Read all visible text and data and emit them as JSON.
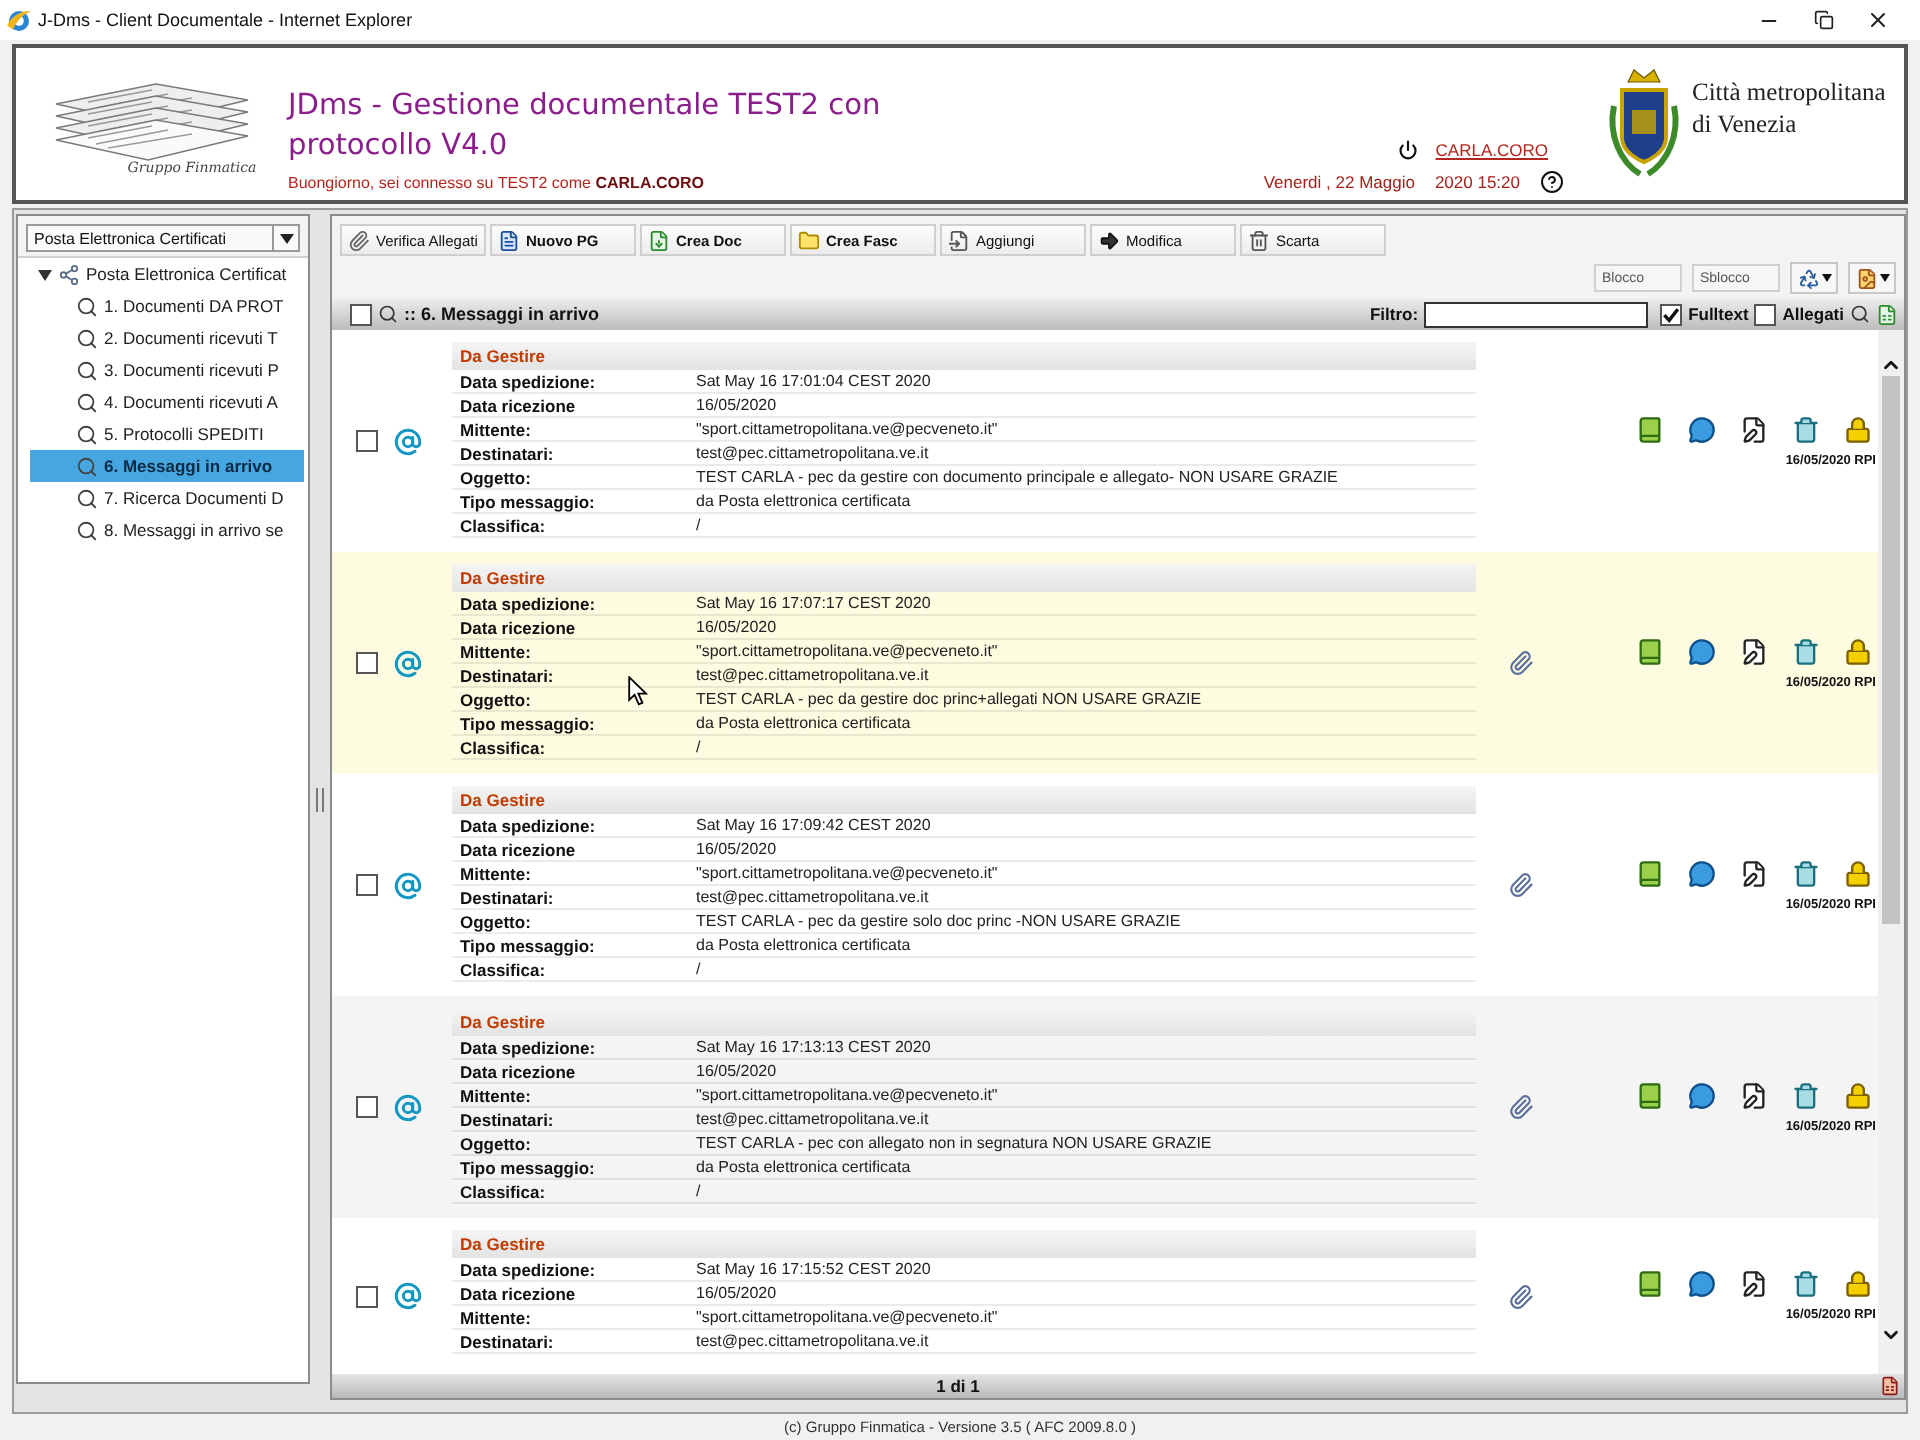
{
  "window": {
    "title": "J-Dms - Client Documentale - Internet Explorer"
  },
  "header": {
    "logo_caption": "Gruppo Finmatica",
    "title": "JDms - Gestione documentale TEST2 con protocollo V4.0",
    "greeting": "Buongiorno, sei connesso su TEST2 come **CARLA.CORO**",
    "user": "CARLA.CORO",
    "date": "Venerdi , 22 Maggio",
    "time": "2020 15:20",
    "organization": "Città metropolitana di Venezia"
  },
  "sidebar": {
    "dropdown": "Posta Elettronica Certificati",
    "tree": [
      {
        "label": "Posta Elettronica Certificat",
        "expanded": true,
        "selected": false,
        "children": [
          {
            "label": "1. Documenti DA PROT",
            "selected": false
          },
          {
            "label": "2. Documenti ricevuti T",
            "selected": false
          },
          {
            "label": "3. Documenti ricevuti P",
            "selected": false
          },
          {
            "label": "4. Documenti ricevuti A",
            "selected": false
          },
          {
            "label": "5. Protocolli SPEDITI",
            "selected": false
          },
          {
            "label": "6. Messaggi in arrivo",
            "selected": true
          },
          {
            "label": "7. Ricerca Documenti D",
            "selected": false
          },
          {
            "label": "8. Messaggi in arrivo se",
            "selected": false
          }
        ]
      }
    ]
  },
  "toolbar": {
    "buttons": [
      {
        "label": "Verifica Allegati",
        "emphasized": false
      },
      {
        "label": "Nuovo PG",
        "emphasized": true
      },
      {
        "label": "Crea Doc",
        "emphasized": true
      },
      {
        "label": "Crea Fasc",
        "emphasized": true
      },
      {
        "label": "Aggiungi",
        "emphasized": false
      },
      {
        "label": "Modifica",
        "emphasized": false
      },
      {
        "label": "Scarta",
        "emphasized": false
      }
    ],
    "lock_buttons": [
      "Blocco",
      "Sblocco"
    ]
  },
  "list": {
    "title": ":: 6. Messaggi in arrivo",
    "select_all": {
      "checked": false
    },
    "filter": {
      "label": "Filtro:"
    },
    "options": [
      {
        "label": "Fulltext",
        "checked": true
      },
      {
        "label": "Allegati",
        "checked": false
      }
    ],
    "messages": [
      {
        "checked": false,
        "hovered": false,
        "status": "Da Gestire",
        "attachment": false,
        "stamp": "16/05/2020 RPI",
        "fields": [
          {
            "label": "Data spedizione:",
            "value": "Sat May 16 17:01:04 CEST 2020"
          },
          {
            "label": "Data ricezione",
            "value": "16/05/2020"
          },
          {
            "label": "Mittente:",
            "value": "\"sport.cittametropolitana.ve@pecveneto.it\""
          },
          {
            "label": "Destinatari:",
            "value": "test@pec.cittametropolitana.ve.it"
          },
          {
            "label": "Oggetto:",
            "value": "TEST CARLA - pec da gestire con documento principale e allegato- NON USARE GRAZIE"
          },
          {
            "label": "Tipo messaggio:",
            "value": "da Posta elettronica certificata"
          },
          {
            "label": "Classifica:",
            "value": "/"
          }
        ]
      },
      {
        "checked": false,
        "hovered": true,
        "status": "Da Gestire",
        "attachment": true,
        "stamp": "16/05/2020 RPI",
        "fields": [
          {
            "label": "Data spedizione:",
            "value": "Sat May 16 17:07:17 CEST 2020"
          },
          {
            "label": "Data ricezione",
            "value": "16/05/2020"
          },
          {
            "label": "Mittente:",
            "value": "\"sport.cittametropolitana.ve@pecveneto.it\""
          },
          {
            "label": "Destinatari:",
            "value": "test@pec.cittametropolitana.ve.it"
          },
          {
            "label": "Oggetto:",
            "value": "TEST CARLA - pec da gestire doc princ+allegati NON USARE GRAZIE"
          },
          {
            "label": "Tipo messaggio:",
            "value": "da Posta elettronica certificata"
          },
          {
            "label": "Classifica:",
            "value": "/"
          }
        ]
      },
      {
        "checked": false,
        "hovered": false,
        "status": "Da Gestire",
        "attachment": true,
        "stamp": "16/05/2020 RPI",
        "fields": [
          {
            "label": "Data spedizione:",
            "value": "Sat May 16 17:09:42 CEST 2020"
          },
          {
            "label": "Data ricezione",
            "value": "16/05/2020"
          },
          {
            "label": "Mittente:",
            "value": "\"sport.cittametropolitana.ve@pecveneto.it\""
          },
          {
            "label": "Destinatari:",
            "value": "test@pec.cittametropolitana.ve.it"
          },
          {
            "label": "Oggetto:",
            "value": "TEST CARLA - pec da gestire solo doc princ -NON USARE GRAZIE"
          },
          {
            "label": "Tipo messaggio:",
            "value": "da Posta elettronica certificata"
          },
          {
            "label": "Classifica:",
            "value": "/"
          }
        ]
      },
      {
        "checked": false,
        "hovered": false,
        "status": "Da Gestire",
        "attachment": true,
        "stamp": "16/05/2020 RPI",
        "fields": [
          {
            "label": "Data spedizione:",
            "value": "Sat May 16 17:13:13 CEST 2020"
          },
          {
            "label": "Data ricezione",
            "value": "16/05/2020"
          },
          {
            "label": "Mittente:",
            "value": "\"sport.cittametropolitana.ve@pecveneto.it\""
          },
          {
            "label": "Destinatari:",
            "value": "test@pec.cittametropolitana.ve.it"
          },
          {
            "label": "Oggetto:",
            "value": "TEST CARLA - pec con allegato non in segnatura NON USARE GRAZIE"
          },
          {
            "label": "Tipo messaggio:",
            "value": "da Posta elettronica certificata"
          },
          {
            "label": "Classifica:",
            "value": "/"
          }
        ]
      },
      {
        "checked": false,
        "hovered": false,
        "status": "Da Gestire",
        "attachment": true,
        "stamp": "16/05/2020 RPI",
        "fields": [
          {
            "label": "Data spedizione:",
            "value": "Sat May 16 17:15:52 CEST 2020"
          },
          {
            "label": "Data ricezione",
            "value": "16/05/2020"
          },
          {
            "label": "Mittente:",
            "value": "\"sport.cittametropolitana.ve@pecveneto.it\""
          },
          {
            "label": "Destinatari:",
            "value": "test@pec.cittametropolitana.ve.it"
          }
        ]
      }
    ]
  },
  "pager": {
    "label": "1 di 1"
  },
  "footer": "(c) Gruppo Finmatica - Versione 3.5 ( AFC 2009.8.0 )"
}
